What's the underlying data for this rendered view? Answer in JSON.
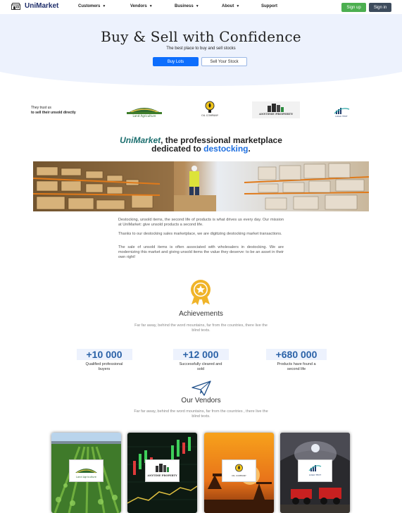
{
  "nav": {
    "brand": "UniMarket",
    "menu": [
      "Customers",
      "Vendors",
      "Business",
      "About",
      "Support"
    ],
    "signup": "Sign up",
    "signin": "Sign in"
  },
  "hero": {
    "title": "Buy & Sell with Confidence",
    "subtitle": "The best place to buy and sell stocks",
    "buy_button": "Buy Lots",
    "sell_button": "Sell Your Stock"
  },
  "trusted": {
    "line1": "They trust us",
    "line2": "to sell their unsold directly",
    "logos": [
      "Land Agriculture",
      "OIL COMPANY",
      "ANYTIME PROPERTY",
      "LOGO TEXT"
    ]
  },
  "intro": {
    "brand": "UniMarket",
    "middle": ", the professional marketplace",
    "line2_start": "dedicated to ",
    "highlight": "destocking",
    "end": "."
  },
  "paragraphs": [
    "Destocking, unsold items, the second life of products is what drives us every day. Our mission at UniMarket: give unsold products a second life.",
    "Thanks to our destocking sales marketplace, we are digitizing destocking market transactions.",
    "The sale of unsold items is often associated with wholesalers in destocking. We are modernizing this market and giving unsold items the value they deserve: to be an asset in their own right!"
  ],
  "achievements": {
    "title": "Achievements",
    "subtitle": "Far far away, behind the word mountains, far from the countries, there live the blind texts.",
    "stats": [
      {
        "value": "+10 000",
        "label": "Qualified professional buyers"
      },
      {
        "value": "+12 000",
        "label": "Successfully cleared and sold"
      },
      {
        "value": "+680 000",
        "label": "Products have found a second life"
      }
    ]
  },
  "vendors": {
    "title": "Our Vendors",
    "subtitle": "Far far away, behind the word mountains, far from the countries , there live the blind texts.",
    "cards": [
      "Land Agriculture",
      "ANYTIME PROPERTY",
      "OIL COMPANY",
      "LOGO TEXT"
    ]
  },
  "colors": {
    "brand": "#1f2e6b",
    "signup": "#4caf50",
    "signin": "#3d4b5c",
    "primary": "#0d6efd",
    "hero_bg": "#edf2fd",
    "stat_number": "#2b62a8",
    "highlight_teal": "#1b6e6e"
  }
}
